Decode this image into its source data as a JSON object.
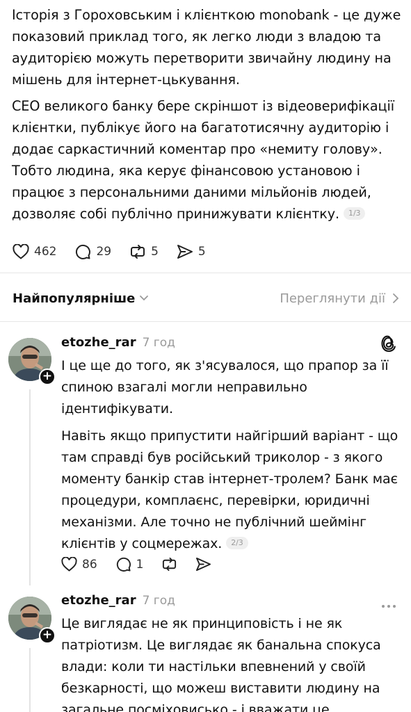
{
  "post": {
    "paragraphs": [
      "Історія з Гороховським і клієнткою monobank - це дуже показовий приклад того, як легко люди з владою та аудиторією можуть перетворити звичайну людину на мішень для інтернет-цькування.",
      "СЕО великого банку бере скріншот із відеоверифікації клієнтки, публікує його на багатотисячну аудиторію і додає саркастичний коментар про «немиту голову». Тобто людина, яка керує фінансовою установою і працює з персональними даними мільйонів людей, дозволяє собі публічно принижувати клієнтку."
    ],
    "pager": "1/3",
    "likes": "462",
    "comments": "29",
    "reposts": "5",
    "shares": "5"
  },
  "sort": {
    "label": "Найпопулярніше",
    "activity_link": "Переглянути дії"
  },
  "comments": [
    {
      "username": "etozhe_rar",
      "time": "7 год",
      "corner_icon": "threads-logo-icon",
      "paragraphs": [
        "І це ще до того, як з'ясувалося, що прапор за її спиною взагалі могли неправильно ідентифікувати.",
        "Навіть якщо припустити найгірший варіант - що там справді був російський триколор - з якого моменту банкір став інтернет-тролем? Банк має процедури, комплаєнс, перевірки, юридичні механізми. Але точно не публічний шеймінг клієнтів у соцмережах."
      ],
      "pager": "2/3",
      "likes": "86",
      "comments": "1"
    },
    {
      "username": "etozhe_rar",
      "time": "7 год",
      "corner_icon": "more-dots-icon",
      "paragraphs": [
        "Це виглядає не як принциповість і не як патріотизм. Це виглядає як банальна спокуса влади: коли ти настільки впевнений у своїй безкарності, що можеш виставити людину на загальне посміховисько - і вважати це"
      ]
    }
  ]
}
